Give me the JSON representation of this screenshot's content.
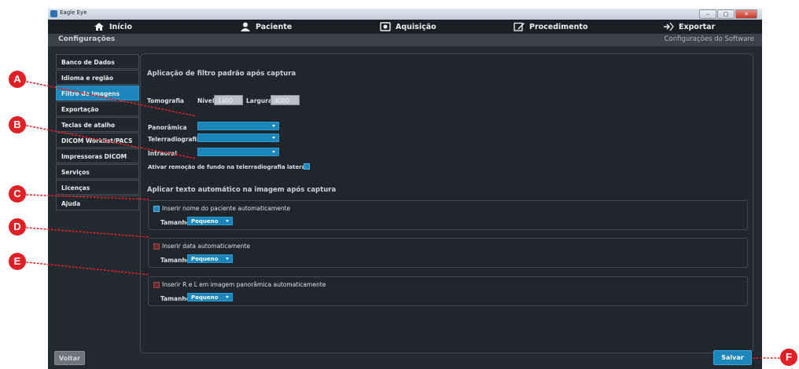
{
  "window": {
    "title": "Eagle Eye"
  },
  "nav": {
    "items": [
      {
        "label": "Início",
        "icon": "home-icon"
      },
      {
        "label": "Paciente",
        "icon": "user-icon"
      },
      {
        "label": "Aquisição",
        "icon": "camera-icon"
      },
      {
        "label": "Procedimento",
        "icon": "edit-icon"
      },
      {
        "label": "Exportar",
        "icon": "export-icon"
      }
    ]
  },
  "subheader": {
    "left": "Configurações",
    "right": "Configurações do Software"
  },
  "sidebar": {
    "items": [
      {
        "label": "Banco de Dados"
      },
      {
        "label": "Idioma e região"
      },
      {
        "label": "Filtro de imagens"
      },
      {
        "label": "Exportação"
      },
      {
        "label": "Teclas de atalho"
      },
      {
        "label": "DICOM Worklist/PACS"
      },
      {
        "label": "Impressoras DICOM"
      },
      {
        "label": "Serviços"
      },
      {
        "label": "Licenças"
      },
      {
        "label": "Ajuda"
      }
    ],
    "active_index": 2
  },
  "filter_section": {
    "title": "Aplicação de filtro padrão após captura",
    "tomografia": {
      "label": "Tomografia",
      "nivel_label": "Nível",
      "nivel_value": "1400",
      "largura_label": "Largura",
      "largura_value": "4000"
    },
    "dropdowns": [
      {
        "label": "Panorâmica",
        "value": ""
      },
      {
        "label": "Telerradiografia",
        "value": ""
      },
      {
        "label": "Intraoral",
        "value": ""
      }
    ],
    "background_removal_label": "Ativar remoção de fundo na telerradiografia lateral"
  },
  "auto_text_section": {
    "title": "Aplicar texto automático na imagem após captura",
    "groups": [
      {
        "checkbox_label": "Inserir nome do paciente automaticamente",
        "size_label": "Tamanho",
        "size_value": "Pequeno",
        "checked": true
      },
      {
        "checkbox_label": "Inserir data automaticamente",
        "size_label": "Tamanho",
        "size_value": "Pequeno",
        "checked": false
      },
      {
        "checkbox_label": "Inserir R e L em imagem panorâmica automaticamente",
        "size_label": "Tamanho",
        "size_value": "Pequeno",
        "checked": false
      }
    ]
  },
  "footer": {
    "back_label": "Voltar",
    "save_label": "Salvar"
  },
  "callouts": [
    "A",
    "B",
    "C",
    "D",
    "E",
    "F"
  ],
  "colors": {
    "accent": "#1d86ba",
    "callout": "#e01f26",
    "background": "#232b30"
  }
}
